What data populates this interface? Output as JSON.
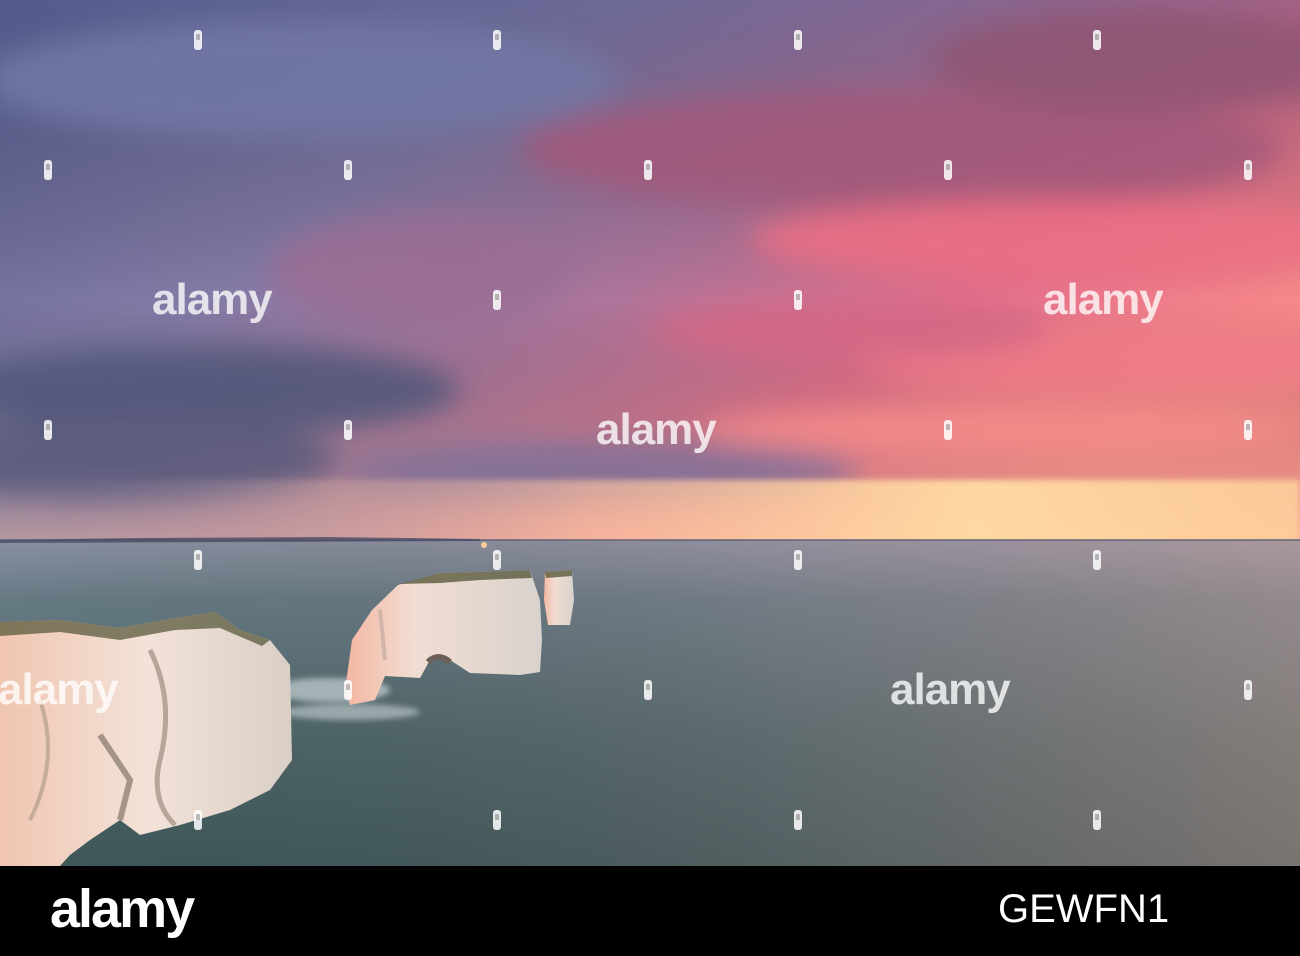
{
  "watermark": {
    "text": "alamy"
  },
  "footer": {
    "logo_text": "alamy",
    "image_id": "GEWFN1"
  },
  "colors": {
    "sky_top": "#6d6f9c",
    "sky_pink": "#f2738a",
    "horizon_glow": "#ffd19a",
    "sea": "#4c6268",
    "cliff": "#e9d7cb",
    "footer_bg": "#000000"
  }
}
